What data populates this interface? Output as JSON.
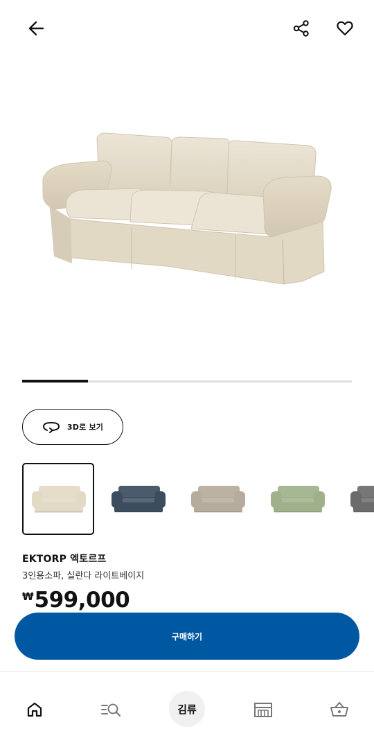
{
  "product": {
    "name": "EKTORP 엑토르프",
    "description": "3인용소파, 실란다 라이트베이지",
    "currency": "₩",
    "price": "599,000",
    "image_progress": 0.2
  },
  "actions": {
    "view_3d_label": "3D로 보기",
    "buy_label": "구매하기"
  },
  "variants": [
    {
      "color_name": "light-beige",
      "color": "#e3dac6",
      "selected": true
    },
    {
      "color_name": "dark-blue",
      "color": "#3c4d60",
      "selected": false
    },
    {
      "color_name": "striped-beige",
      "color": "#b6ab9c",
      "selected": false
    },
    {
      "color_name": "light-green",
      "color": "#9fb08a",
      "selected": false
    },
    {
      "color_name": "dark-gray",
      "color": "#6b6b6b",
      "selected": false
    }
  ],
  "nav": {
    "items": [
      {
        "icon": "home-icon"
      },
      {
        "icon": "search-list-icon"
      },
      {
        "icon": "kiosk-label",
        "label": "김류"
      },
      {
        "icon": "store-icon"
      },
      {
        "icon": "basket-icon"
      }
    ]
  },
  "colors": {
    "accent": "#0058a3",
    "text": "#111111",
    "sofa": "#e8e0cf"
  }
}
